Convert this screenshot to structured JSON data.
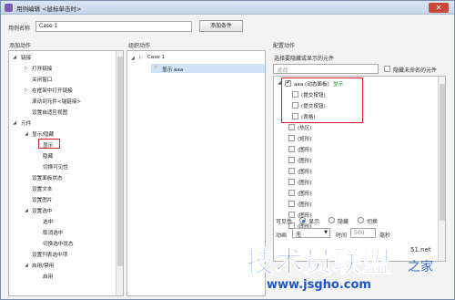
{
  "window": {
    "title": "用例编辑 <鼠标单击时>",
    "close_label": "✕"
  },
  "case_name": {
    "label": "用例名称",
    "value": "Case 1",
    "add_condition": "添加条件"
  },
  "left": {
    "header": "添加动作",
    "items": [
      "链接",
      "打开链接",
      "关闭窗口",
      "在框架中打开链接",
      "滚动到元件<锚链接>",
      "设置自适应视图",
      "元件",
      "显示/隐藏",
      "显示",
      "隐藏",
      "切换可见性",
      "设置面板状态",
      "设置文本",
      "设置图片",
      "设置选中",
      "选中",
      "取消选中",
      "切换选中状态",
      "设置列表选中项",
      "启用/禁用",
      "启用"
    ]
  },
  "middle": {
    "header": "组织动作",
    "case_label": "Case 1",
    "action_label": "显示 aaa"
  },
  "right": {
    "header": "配置动作",
    "subheader": "选择要隐藏或显示的元件",
    "search_placeholder": "查找",
    "hide_unnamed": "隐藏未命名的元件",
    "tree": [
      {
        "text": "aaa (动态面板)",
        "extra": "显示",
        "checked": true
      },
      {
        "text": "(提交按钮)",
        "checked": false
      },
      {
        "text": "(提交按钮)",
        "checked": false
      },
      {
        "text": "(表格)",
        "checked": false
      },
      {
        "text": "(热区)",
        "checked": false
      },
      {
        "text": "(矩形)",
        "checked": false
      },
      {
        "text": "(图形)",
        "checked": false
      },
      {
        "text": "(图形)",
        "checked": false
      },
      {
        "text": "(图形)",
        "checked": false
      },
      {
        "text": "(图形)",
        "checked": false
      },
      {
        "text": "(图形)",
        "checked": false
      },
      {
        "text": "(图形)",
        "checked": false
      },
      {
        "text": "(图形)",
        "checked": false
      },
      {
        "text": "(图形)",
        "checked": false
      }
    ],
    "visibility_label": "可见性",
    "visibility_options": [
      "显示",
      "隐藏",
      "切换"
    ],
    "anim_label": "动画",
    "anim_value": "无",
    "time_label": "时间",
    "time_value": "500",
    "time_unit": "毫秒"
  },
  "watermark": {
    "main": "技术员联盟",
    "url": "www.jsgho.com",
    "side": "之家",
    "side_small": "51.net"
  }
}
